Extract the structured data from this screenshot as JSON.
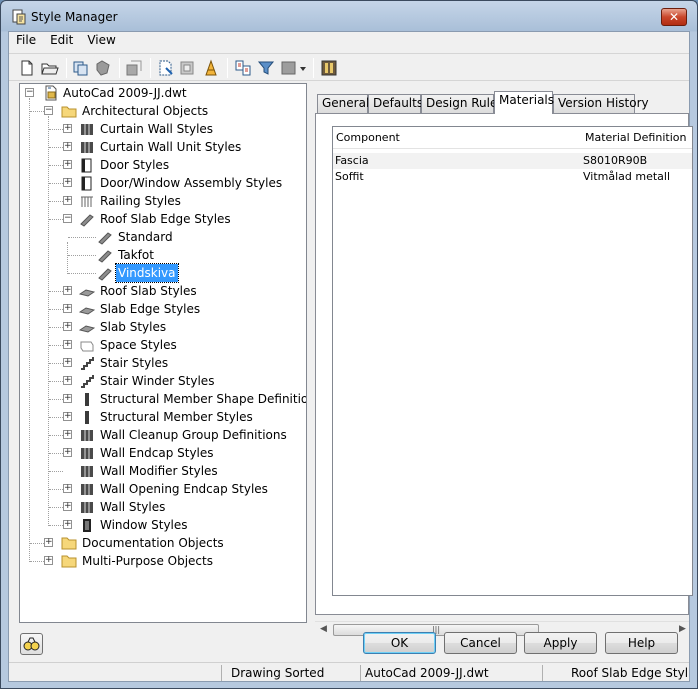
{
  "window": {
    "title": "Style Manager",
    "close_glyph": "✕"
  },
  "menu": [
    "File",
    "Edit",
    "View"
  ],
  "toolbar": {
    "icons": [
      "new-drawing-icon",
      "open-drawing-icon",
      "copy-icon",
      "paste-icon",
      "edit-style-icon",
      "purge-icon",
      "toggle-view-icon",
      "style-icon",
      "sort-icon",
      "filter-icon",
      "inline-edit-icon",
      "help-icon"
    ]
  },
  "tree": {
    "root": "AutoCad 2009-JJ.dwt",
    "arch": "Architectural Objects",
    "items": [
      "Curtain Wall Styles",
      "Curtain Wall Unit Styles",
      "Door Styles",
      "Door/Window Assembly Styles",
      "Railing Styles",
      "Roof Slab Edge Styles",
      "Standard",
      "Takfot",
      "Vindskiva",
      "Roof Slab Styles",
      "Slab Edge Styles",
      "Slab Styles",
      "Space Styles",
      "Stair Styles",
      "Stair Winder Styles",
      "Structural Member Shape Definitions",
      "Structural Member Styles",
      "Wall Cleanup Group Definitions",
      "Wall Endcap Styles",
      "Wall Modifier Styles",
      "Wall Opening Endcap Styles",
      "Wall Styles",
      "Window Styles"
    ],
    "doc": "Documentation Objects",
    "multi": "Multi-Purpose Objects",
    "selected": "Vindskiva"
  },
  "tabs": [
    "General",
    "Defaults",
    "Design Rules",
    "Materials",
    "Version History"
  ],
  "active_tab": "Materials",
  "materials": {
    "columns": [
      "Component",
      "Material Definition"
    ],
    "rows": [
      [
        "Fascia",
        "S8010R90B"
      ],
      [
        "Soffit",
        "Vitmålad metall"
      ]
    ]
  },
  "buttons": {
    "ok": "OK",
    "cancel": "Cancel",
    "apply": "Apply",
    "help": "Help"
  },
  "status": {
    "sort": "Drawing Sorted",
    "drawing": "AutoCad 2009-JJ.dwt",
    "style": "Roof Slab Edge Styl"
  },
  "colors": {
    "selection": "#3399ff",
    "title_bar": "#b6c9df",
    "close": "#c9462b"
  }
}
